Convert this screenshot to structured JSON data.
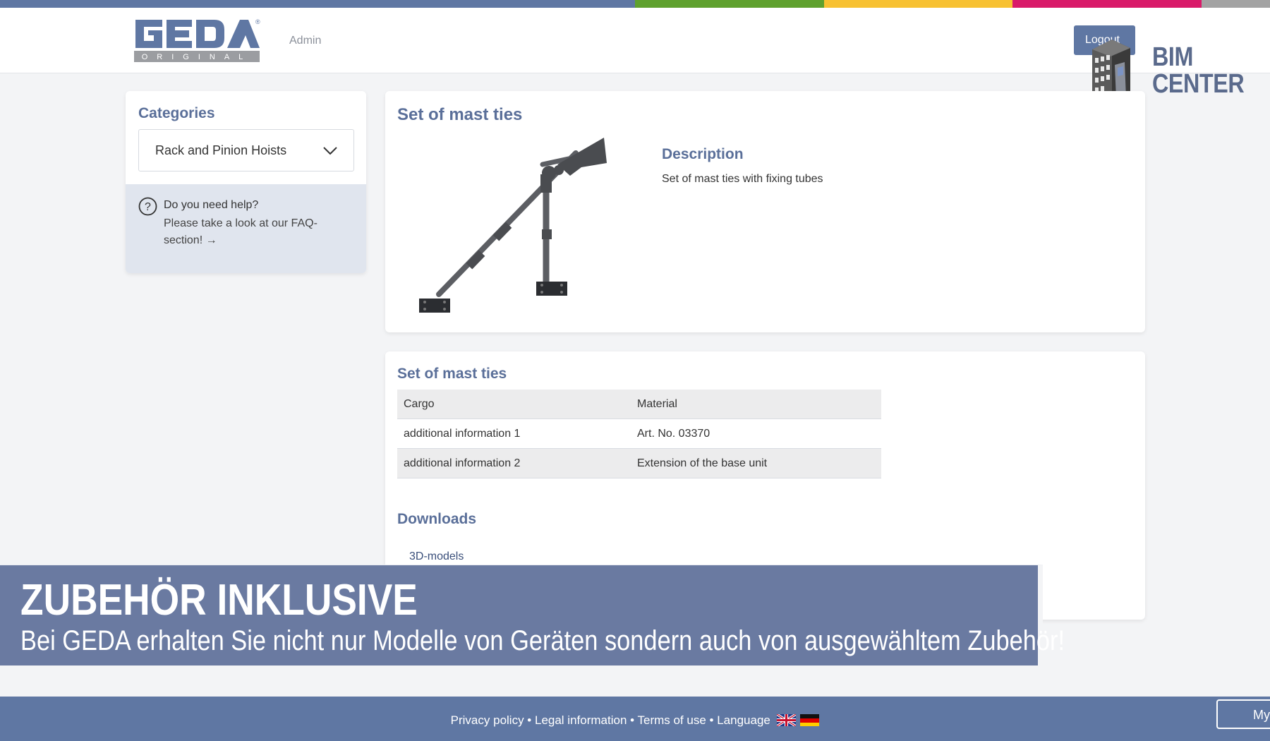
{
  "header": {
    "brand": "GEDA",
    "brand_sub": "ORIGINAL",
    "user_role": "Admin",
    "logout_label": "Logout"
  },
  "watermark": {
    "line1": "BIM",
    "line2": "CENTER"
  },
  "colors": {
    "accent": "#5f77a3",
    "heading": "#5a6f99",
    "bar_green": "#5fa12e",
    "bar_yellow": "#f7c132",
    "bar_pink": "#d91a69",
    "bar_gray": "#a3a3a3"
  },
  "sidebar": {
    "title": "Categories",
    "category_select": "Rack and Pinion Hoists",
    "help_title": "Do you need help?",
    "help_text": "Please take a look at our FAQ-section! →"
  },
  "product": {
    "title": "Set of mast ties",
    "description_heading": "Description",
    "description_text": "Set of mast ties with fixing tubes"
  },
  "details": {
    "title": "Set of mast ties",
    "table": [
      {
        "label": "Cargo",
        "value": "Material"
      },
      {
        "label": "additional information 1",
        "value": "Art. No. 03370"
      },
      {
        "label": "additional information 2",
        "value": "Extension of the base unit"
      }
    ],
    "downloads_heading": "Downloads",
    "downloads": [
      "3D-models"
    ]
  },
  "banner": {
    "title": "ZUBEHÖR INKLUSIVE",
    "subtitle": "Bei GEDA erhalten Sie nicht nur Modelle von Geräten sondern auch von ausgewähltem Zubehör!"
  },
  "footer": {
    "privacy": "Privacy policy",
    "legal": "Legal information",
    "terms": "Terms of use",
    "language": "Language",
    "separator": " • ",
    "my_button": "My"
  }
}
